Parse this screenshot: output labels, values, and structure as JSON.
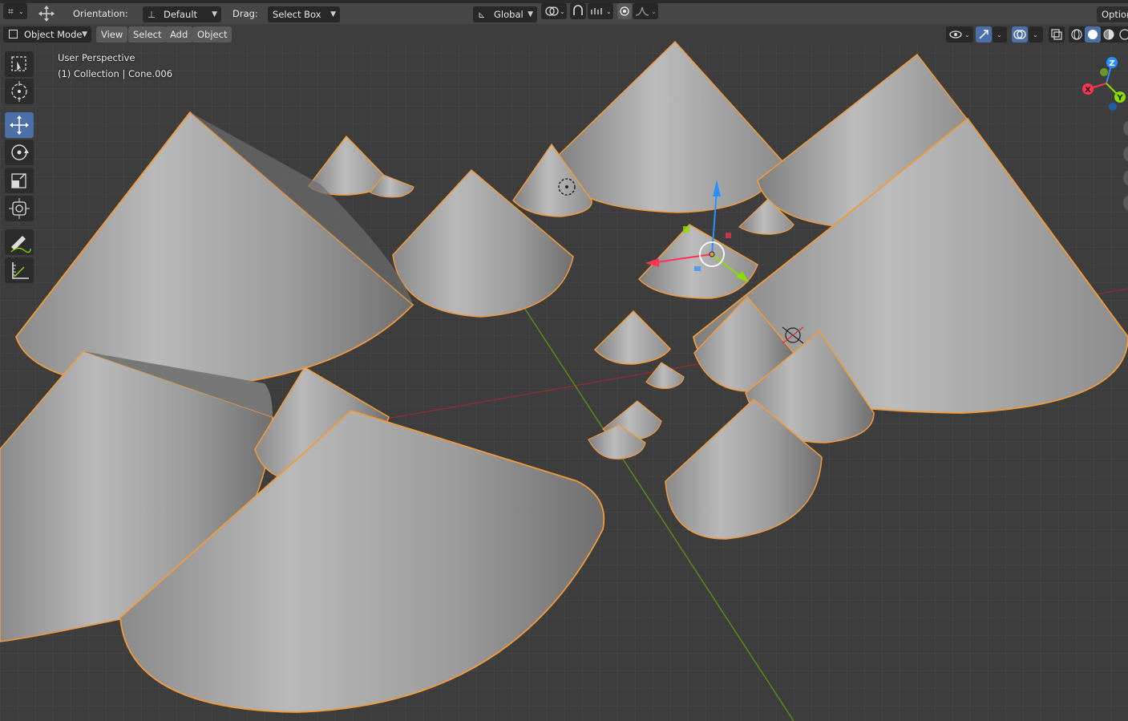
{
  "header": {
    "orientation_label": "Orientation:",
    "orientation_value": "Default",
    "drag_label": "Drag:",
    "drag_value": "Select Box",
    "transform_space": "Global",
    "options_label": "Options"
  },
  "viewport_header": {
    "mode": "Object Mode",
    "menus": [
      "View",
      "Select",
      "Add",
      "Object"
    ]
  },
  "overlay": {
    "perspective": "User Perspective",
    "collection": "(1) Collection | Cone.006"
  },
  "gizmo": {
    "axes": [
      "Z",
      "X",
      "Y"
    ],
    "colors": {
      "x": "#ff3352",
      "y": "#8bdc00",
      "z": "#2890ff"
    }
  },
  "tools": [
    "select-box-icon",
    "cursor-icon",
    "move-icon",
    "rotate-icon",
    "scale-icon",
    "transform-icon",
    "annotate-icon",
    "measure-icon"
  ],
  "colors": {
    "selection_outline": "#f29a3a",
    "active_tool": "#4b6fa6",
    "grid_bg": "#3d3d3d"
  }
}
